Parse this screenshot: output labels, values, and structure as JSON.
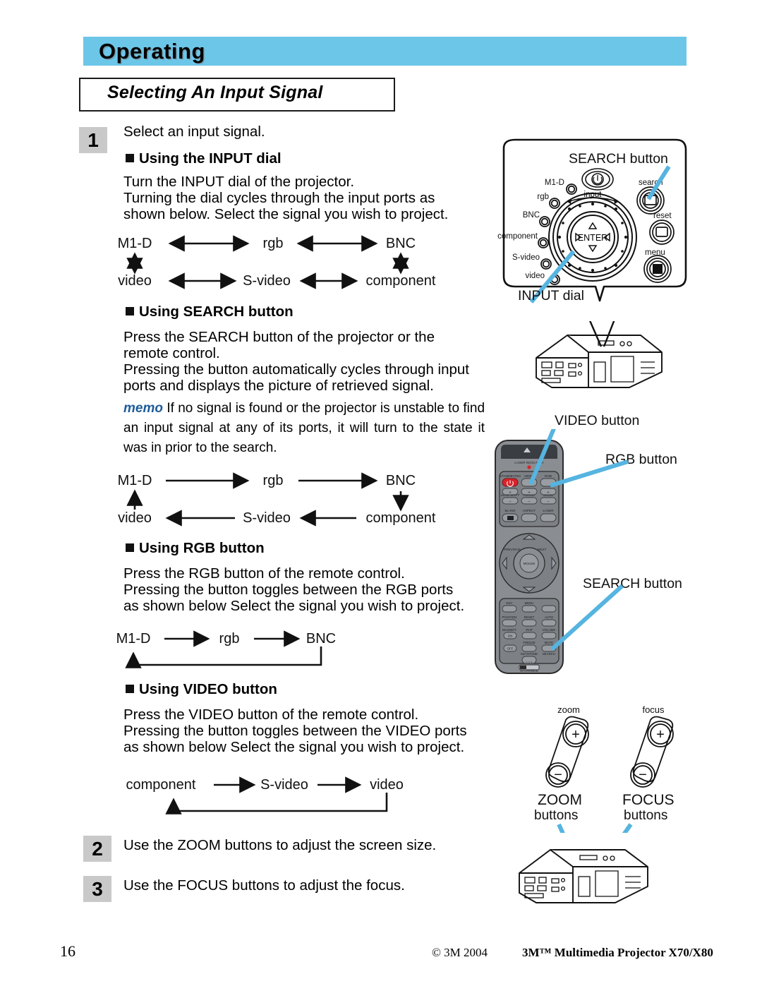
{
  "header": {
    "chapter_title": "Operating",
    "section_title": "Selecting An Input Signal",
    "band_color": "#6cc6e8"
  },
  "steps": [
    {
      "number": "1",
      "text": "Select an input signal."
    },
    {
      "number": "2",
      "text": "Use the ZOOM buttons to adjust the screen size."
    },
    {
      "number": "3",
      "text": "Use the FOCUS buttons to adjust the focus."
    }
  ],
  "sections": {
    "input_dial": {
      "heading": "Using the INPUT dial",
      "body_line1": "Turn the INPUT dial of the projector.",
      "body_line2": "Turning the dial cycles through the input ports as",
      "body_line3": "shown below. Select the signal you wish to project."
    },
    "search_button": {
      "heading": "Using SEARCH button",
      "body_line1": "Press the SEARCH button of the projector or the",
      "body_line2": "remote control.",
      "body_line3": "Pressing the button automatically cycles through input",
      "body_line4": "ports and displays the picture of retrieved signal.",
      "memo_label": "memo",
      "memo_text": "If no signal is found or the projector is unstable to find an input signal at any of its ports, it will turn to the state it was in prior to the search."
    },
    "rgb_button": {
      "heading": "Using RGB button",
      "body_line1": "Press the RGB button of the remote control.",
      "body_line2": "Pressing the button toggles between the RGB ports",
      "body_line3": "as shown below Select the signal you wish to project."
    },
    "video_button": {
      "heading": "Using VIDEO button",
      "body_line1": "Press the VIDEO button of the remote control.",
      "body_line2": "Pressing the button toggles between the VIDEO ports",
      "body_line3": "as shown below Select the signal you wish to project."
    }
  },
  "diagrams": {
    "dial_cycle": {
      "top_row": [
        "M1-D",
        "rgb",
        "BNC"
      ],
      "bottom_row": [
        "video",
        "S-video",
        "component"
      ],
      "arrow_style": "bidirectional"
    },
    "search_cycle": {
      "top_row": [
        "M1-D",
        "rgb",
        "BNC"
      ],
      "bottom_row": [
        "video",
        "S-video",
        "component"
      ],
      "arrow_style": "unidirectional-loop"
    },
    "rgb_cycle": {
      "nodes": [
        "M1-D",
        "rgb",
        "BNC"
      ],
      "arrow_style": "unidirectional-loopback"
    },
    "video_cycle": {
      "nodes": [
        "component",
        "S-video",
        "video"
      ],
      "arrow_style": "unidirectional-loopback"
    }
  },
  "illustrations": {
    "control_panel": {
      "callout_search": "SEARCH button",
      "callout_input_dial": "INPUT dial",
      "led_labels": [
        "M1-D",
        "rgb",
        "BNC",
        "component",
        "S-video",
        "video"
      ],
      "dial_label": "input",
      "enter_label": "ENTER",
      "button_labels": [
        "search",
        "reset",
        "menu"
      ],
      "pointer_color": "#56b4e0"
    },
    "remote": {
      "callout_video": "VIDEO button",
      "callout_rgb": "RGB button",
      "callout_search": "SEARCH button",
      "indicator_label": "LASER INDICATOR",
      "buttons_row1": [
        "STANDBY/ON",
        "VIDEO",
        "RGB"
      ],
      "buttons_row2": [
        "LENS SHIFT",
        "FOCUS",
        "ZOOM"
      ],
      "buttons_row3": [
        "BLANK",
        "ASPECT",
        "LASER"
      ],
      "nav_labels": [
        "PREVIOUS",
        "NEXT",
        "MOUSE"
      ],
      "buttons_row4": [
        "ESC",
        "MENU"
      ],
      "buttons_row5": [
        "POSITION",
        "RESET",
        "AUTO"
      ],
      "buttons_row6": [
        "MAGNIFY",
        "PinP",
        "VOLUME"
      ],
      "buttons_row7": [
        "ON",
        "FREEZE",
        "MUTE"
      ],
      "buttons_row8": [
        "OFF",
        "KEYSTONE",
        "SEARCH"
      ],
      "id_switch_label": "ID CHANGE",
      "id_switch_positions": "1 2 3",
      "power_color": "#d8232a"
    },
    "lens_buttons": {
      "zoom_small_label": "zoom",
      "focus_small_label": "focus",
      "zoom_caption_line1": "ZOOM",
      "zoom_caption_line2": "buttons",
      "focus_caption_line1": "FOCUS",
      "focus_caption_line2": "buttons",
      "plus_symbol": "+",
      "minus_symbol": "−"
    }
  },
  "footer": {
    "page_number": "16",
    "copyright": "© 3M 2004",
    "model": "3M™ Multimedia Projector X70/X80"
  }
}
